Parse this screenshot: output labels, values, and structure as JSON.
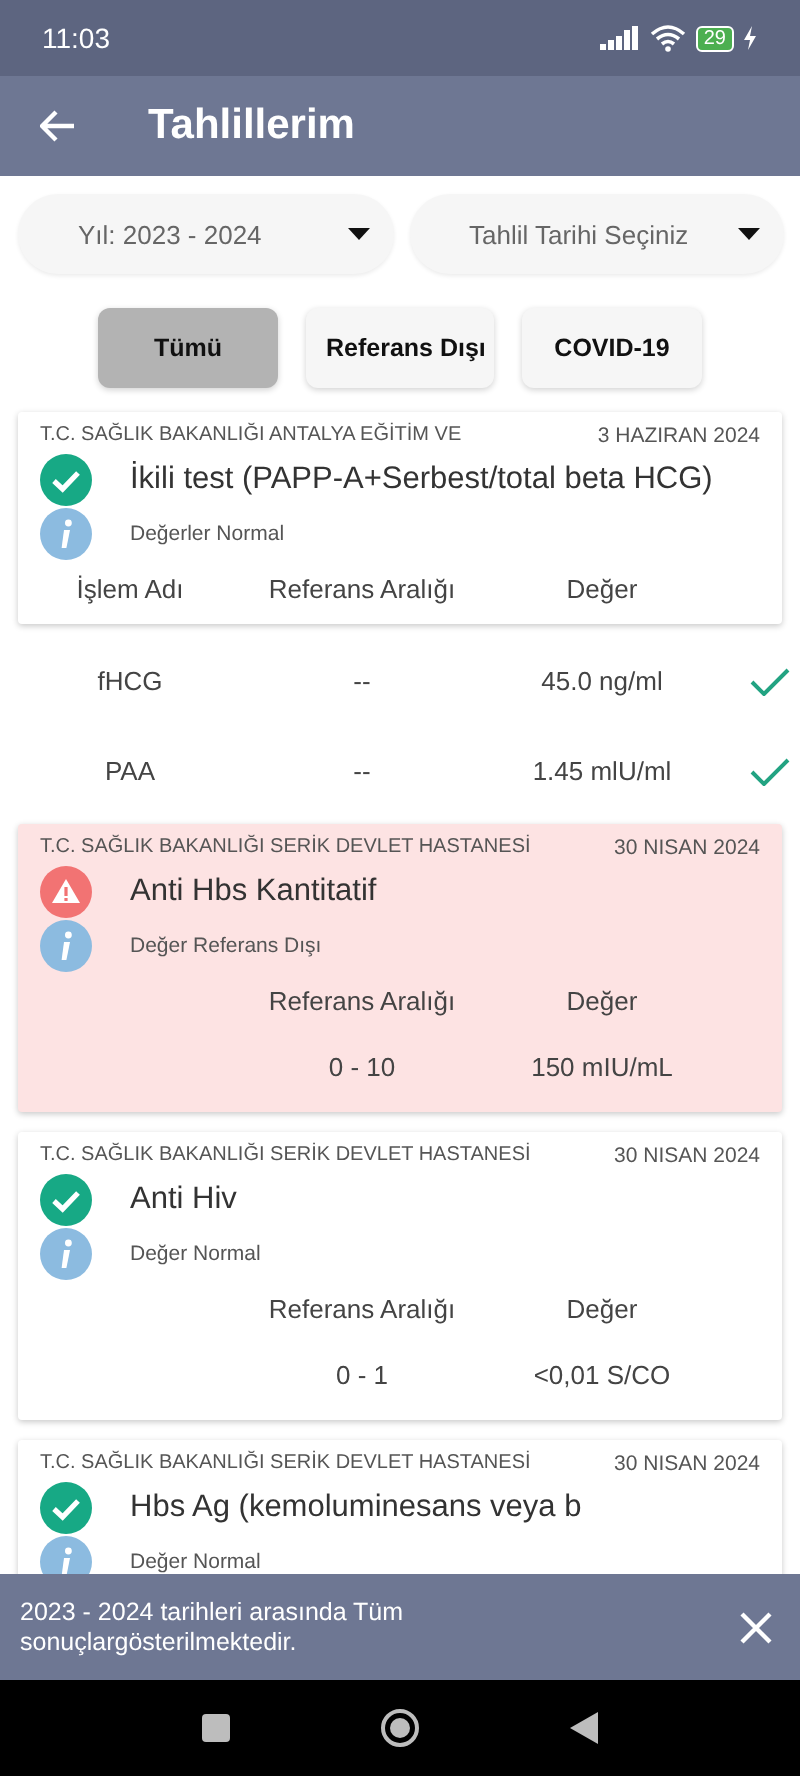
{
  "status_bar": {
    "time": "11:03",
    "battery": "29"
  },
  "app_bar": {
    "title": "Tahlillerim"
  },
  "dropdowns": [
    {
      "value": "Yıl: 2023 - 2024"
    },
    {
      "value": "Tahlil Tarihi Seçiniz"
    }
  ],
  "filters": [
    {
      "label": "Tümü",
      "selected": true
    },
    {
      "label": "Referans Dışı",
      "selected": false
    },
    {
      "label": "COVID-19",
      "selected": false
    }
  ],
  "results": [
    {
      "kind": "multi",
      "institution": "T.C. SAĞLIK BAKANLIĞI ANTALYA EĞİTİM VE",
      "date": "3 HAZIRAN 2024",
      "out_of_range": false,
      "test": "İkili test (PAPP-A+Serbest/total beta HCG)",
      "note": "Değerler Normal",
      "columns": {
        "name": "İşlem Adı",
        "range": "Referans Aralığı",
        "value": "Değer"
      },
      "rows": [
        {
          "name": "fHCG",
          "range": "--",
          "value": "45.0 ng/ml",
          "ok": true
        },
        {
          "name": "PAA",
          "range": "--",
          "value": "1.45 mlU/ml",
          "ok": true
        }
      ]
    },
    {
      "kind": "single",
      "institution": "T.C. SAĞLIK BAKANLIĞI SERİK DEVLET HASTANESİ",
      "date": "30 NISAN 2024",
      "out_of_range": true,
      "test": "Anti Hbs Kantitatif",
      "note": "Değer Referans Dışı",
      "columns": {
        "range": "Referans Aralığı",
        "value": "Değer"
      },
      "rows": [
        {
          "range": "0 - 10",
          "value": "150 mIU/mL"
        }
      ]
    },
    {
      "kind": "single",
      "institution": "T.C. SAĞLIK BAKANLIĞI SERİK DEVLET HASTANESİ",
      "date": "30 NISAN 2024",
      "out_of_range": false,
      "test": "Anti Hiv",
      "note": "Değer Normal",
      "columns": {
        "range": "Referans Aralığı",
        "value": "Değer"
      },
      "rows": [
        {
          "range": "0 - 1",
          "value": "<0,01 S/CO"
        }
      ]
    },
    {
      "kind": "single",
      "institution": "T.C. SAĞLIK BAKANLIĞI SERİK DEVLET HASTANESİ",
      "date": "30 NISAN 2024",
      "out_of_range": false,
      "test": "Hbs Ag  (kemoluminesans veya b",
      "note": "Değer Normal"
    }
  ],
  "snackbar": {
    "message": "2023 - 2024 tarihleri arasında Tüm sonuçlargösterilmektedir."
  }
}
